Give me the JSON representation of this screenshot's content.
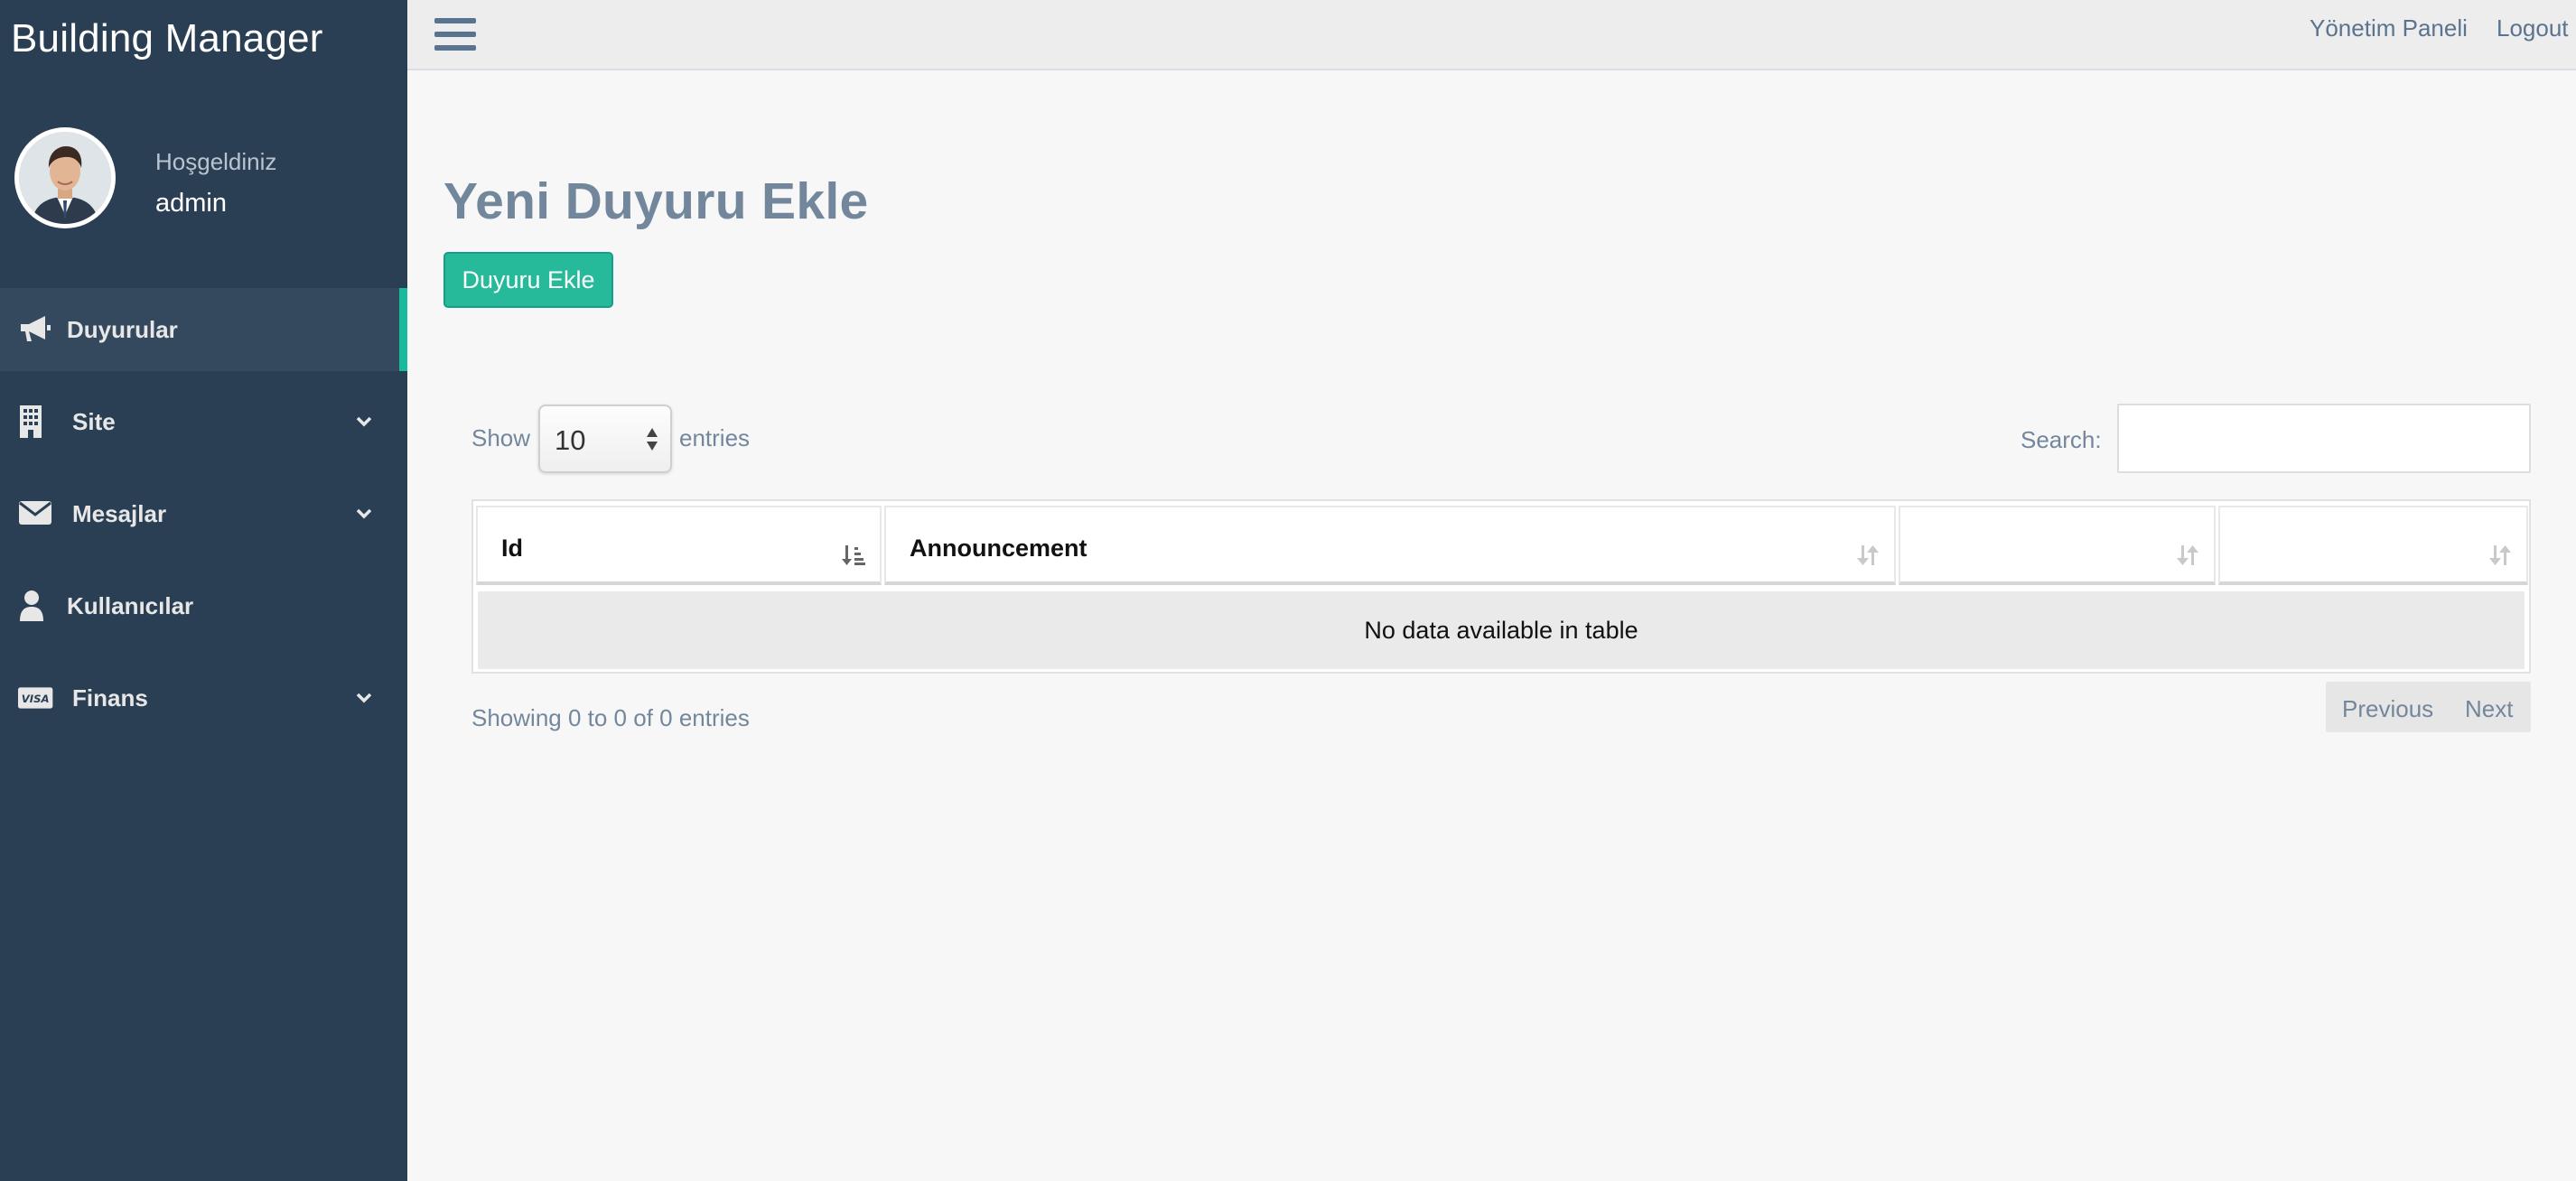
{
  "sidebar": {
    "brand": "Building Manager",
    "welcome": "Hoşgeldiniz",
    "username": "admin",
    "items": [
      {
        "label": "Duyurular",
        "icon": "bullhorn-icon",
        "active": true
      },
      {
        "label": "Site",
        "icon": "building-icon",
        "has_submenu": true
      },
      {
        "label": "Mesajlar",
        "icon": "envelope-icon",
        "has_submenu": true
      },
      {
        "label": "Kullanıcılar",
        "icon": "user-icon"
      },
      {
        "label": "Finans",
        "icon": "visa-card-icon",
        "has_submenu": true
      }
    ]
  },
  "topbar": {
    "menu_icon": "hamburger-menu-icon",
    "links": [
      "Yönetim Paneli",
      "Logout"
    ]
  },
  "main": {
    "title": "Yeni Duyuru Ekle",
    "add_button": "Duyuru Ekle",
    "table": {
      "show_label": "Show",
      "page_length": "10",
      "entries_label": "entries",
      "search_label": "Search:",
      "search_value": "",
      "columns": [
        "Id",
        "Announcement",
        "",
        ""
      ],
      "empty_message": "No data available in table",
      "info": "Showing 0 to 0 of 0 entries",
      "pagination": {
        "previous": "Previous",
        "next": "Next"
      }
    }
  },
  "colors": {
    "sidebar_bg": "#2a3f54",
    "accent": "#1abb9c",
    "button_green": "#26b99a",
    "muted_text": "#73879c"
  }
}
